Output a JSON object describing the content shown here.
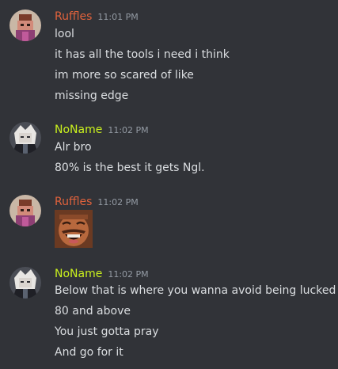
{
  "colors": {
    "background": "#313338",
    "text": "#dbdee1",
    "timestamp": "#949ba4",
    "ruffles": "#e0623c",
    "noname": "#c9f01e"
  },
  "messages": [
    {
      "author": "Ruffles",
      "timestamp": "11:01 PM",
      "avatar_icon": "pixel-character-avatar",
      "lines": [
        "lool",
        "it has all the tools i need i think",
        "im more so scared of like",
        "missing edge"
      ]
    },
    {
      "author": "NoName",
      "timestamp": "11:02 PM",
      "avatar_icon": "anime-character-avatar",
      "lines": [
        "Alr bro",
        "80% is the best it gets Ngl."
      ]
    },
    {
      "author": "Ruffles",
      "timestamp": "11:02 PM",
      "avatar_icon": "pixel-character-avatar",
      "attachment_icon": "laughing-man-emoji"
    },
    {
      "author": "NoName",
      "timestamp": "11:02 PM",
      "avatar_icon": "anime-character-avatar",
      "lines": [
        "Below that is where you wanna avoid being lucked",
        "80 and above",
        "You just gotta pray",
        "And go for it"
      ]
    }
  ]
}
